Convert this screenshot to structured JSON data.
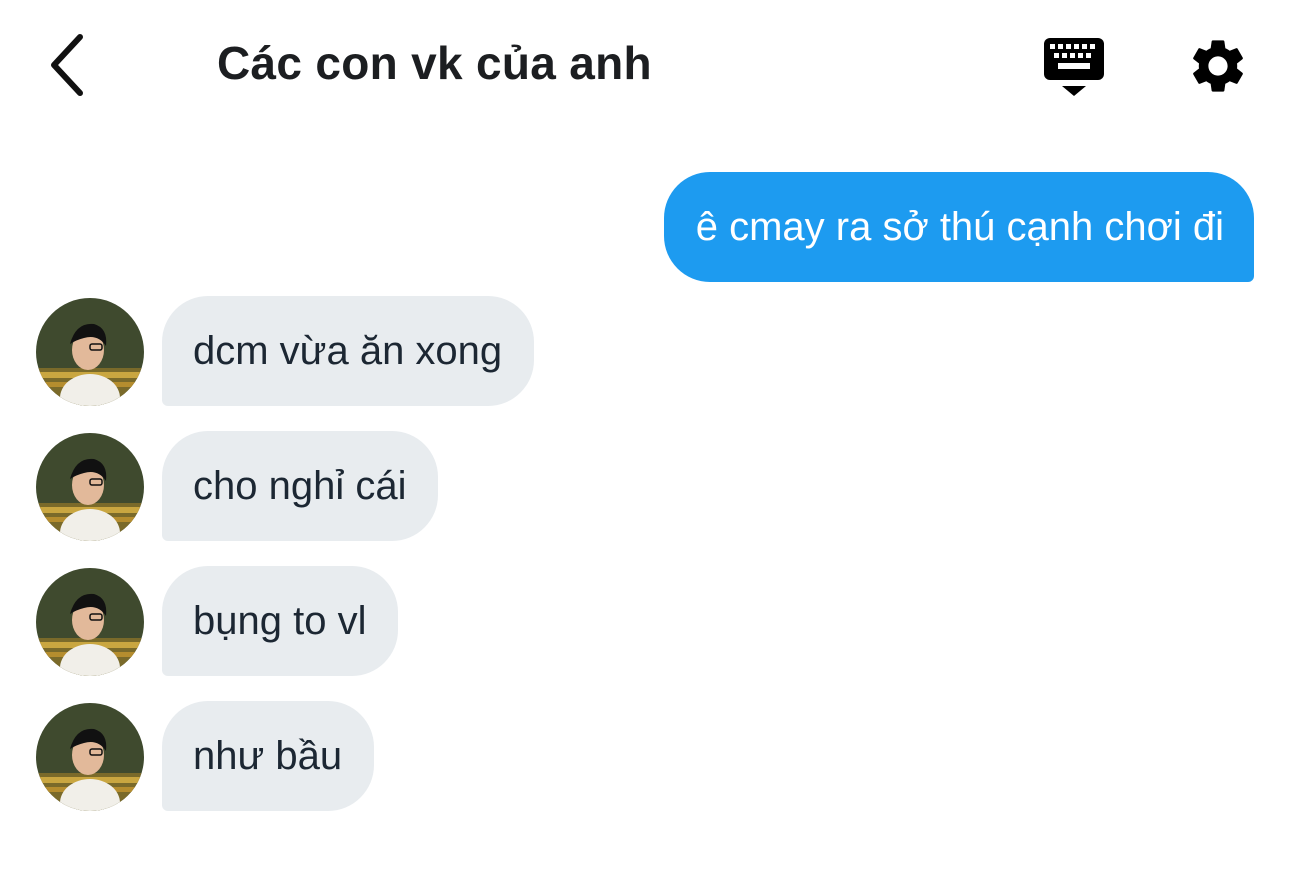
{
  "header": {
    "title": "Các con vk của anh",
    "back_icon": "chevron-left-icon",
    "keyboard_icon": "keyboard-icon",
    "settings_icon": "gear-icon"
  },
  "messages": [
    {
      "direction": "sent",
      "text": "ê cmay ra sở thú cạnh chơi đi"
    },
    {
      "direction": "received",
      "text": "dcm vừa ăn xong"
    },
    {
      "direction": "received",
      "text": "cho nghỉ cái"
    },
    {
      "direction": "received",
      "text": "bụng to vl"
    },
    {
      "direction": "received",
      "text": "như bầu"
    }
  ],
  "colors": {
    "sent_bubble": "#1d9bf0",
    "received_bubble": "#e8ecef",
    "background": "#ffffff",
    "title_text": "#1c1e21"
  }
}
